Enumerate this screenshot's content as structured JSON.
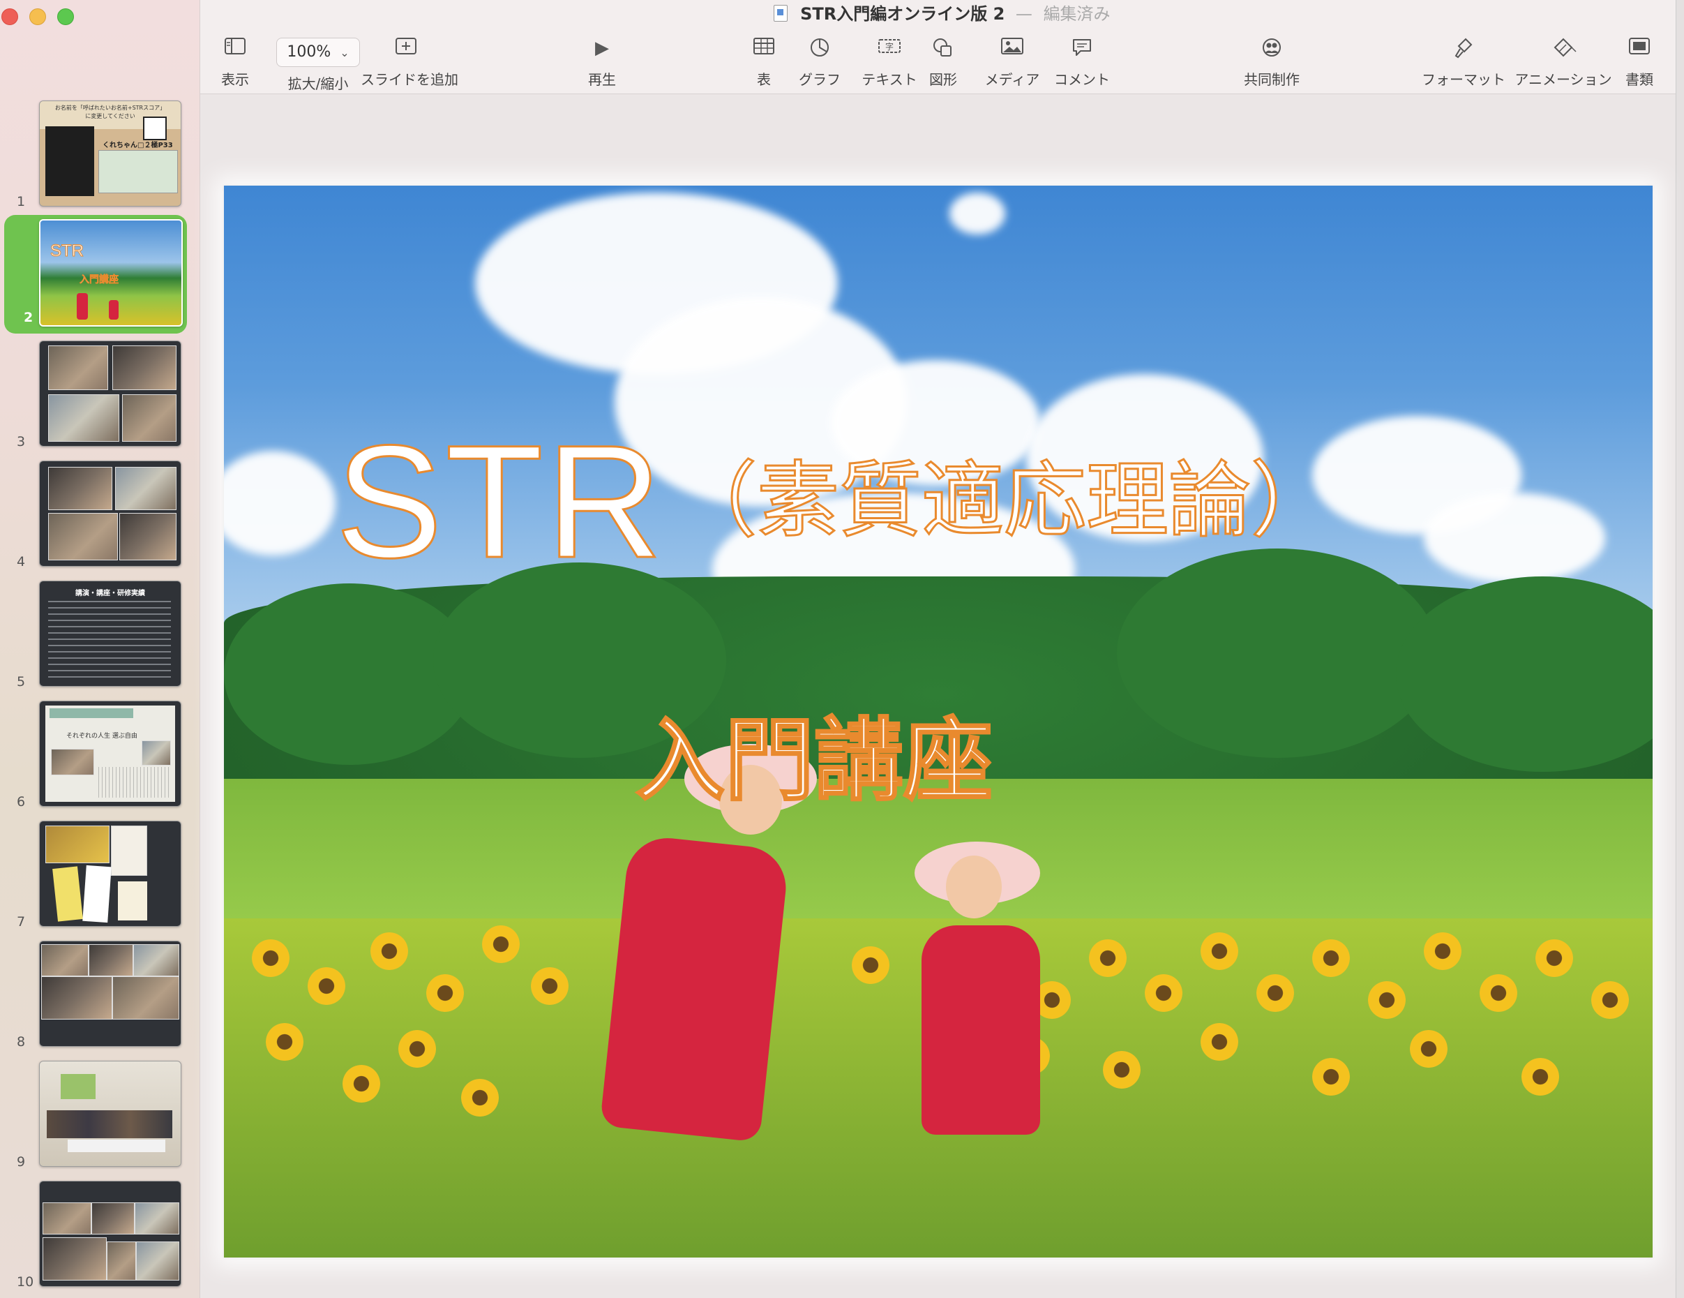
{
  "window": {
    "title": "STR入門編オンライン版 2",
    "separator": "—",
    "status": "編集済み"
  },
  "toolbar": {
    "view_label": "表示",
    "zoom_value": "100%",
    "zoom_label": "拡大/縮小",
    "add_slide_label": "スライドを追加",
    "play_label": "再生",
    "table_label": "表",
    "chart_label": "グラフ",
    "text_label": "テキスト",
    "shape_label": "図形",
    "media_label": "メディア",
    "comment_label": "コメント",
    "collaborate_label": "共同制作",
    "format_label": "フォーマット",
    "animate_label": "アニメーション",
    "document_label": "書類"
  },
  "slides": [
    {
      "number": "1",
      "thumb_text_1": "お名前を「呼ばれたいお名前+STRスコア」",
      "thumb_text_2": "に変更してください",
      "thumb_text_3": "くれちゃん□２極P33"
    },
    {
      "number": "2",
      "thumb_title": "STR",
      "thumb_sub": "入門講座"
    },
    {
      "number": "3"
    },
    {
      "number": "4"
    },
    {
      "number": "5",
      "thumb_title": "講演・講座・研修実績"
    },
    {
      "number": "6",
      "thumb_title": "それぞれの人生 選ぶ自由"
    },
    {
      "number": "7"
    },
    {
      "number": "8"
    },
    {
      "number": "9"
    },
    {
      "number": "10"
    }
  ],
  "current_slide": {
    "title_main": "STR",
    "title_paren": "（素質適応理論）",
    "subtitle": "入門講座"
  },
  "colors": {
    "selection": "#6fc34f",
    "title_outline": "#e98a2e",
    "dress": "#d5253f"
  }
}
